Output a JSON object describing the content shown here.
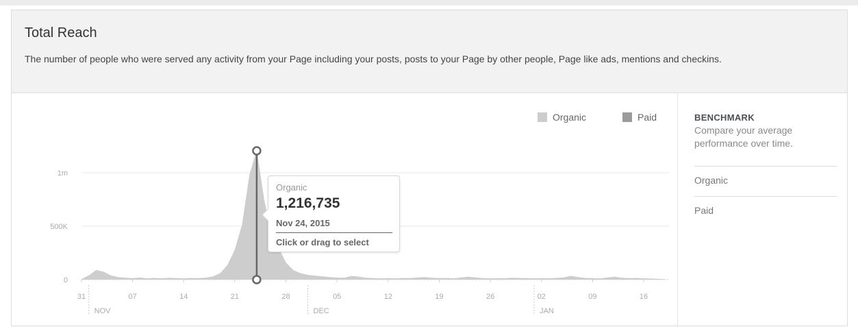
{
  "header": {
    "title": "Total Reach",
    "description": "The number of people who were served any activity from your Page including your posts, posts to your Page by other people, Page like ads, mentions and checkins."
  },
  "legend": [
    {
      "label": "Organic",
      "color": "#cdcdcd"
    },
    {
      "label": "Paid",
      "color": "#9b9b9b"
    }
  ],
  "benchmark": {
    "title": "BENCHMARK",
    "description": "Compare your average performance over time.",
    "items": [
      "Organic",
      "Paid"
    ]
  },
  "tooltip": {
    "series": "Organic",
    "value": "1,216,735",
    "date": "Nov 24, 2015",
    "hint": "Click or drag to select"
  },
  "chart_data": {
    "type": "area",
    "title": "Total Reach",
    "x_start": "2015-10-31",
    "x_end": "2016-01-19",
    "x_unit": "date",
    "ylim": [
      0,
      1300000
    ],
    "y_ticks": [
      {
        "value": 0,
        "label": "0"
      },
      {
        "value": 500000,
        "label": "500K"
      },
      {
        "value": 1000000,
        "label": "1m"
      }
    ],
    "x_ticks": [
      {
        "date": "2015-10-31",
        "label": "31"
      },
      {
        "date": "2015-11-07",
        "label": "07"
      },
      {
        "date": "2015-11-14",
        "label": "14"
      },
      {
        "date": "2015-11-21",
        "label": "21"
      },
      {
        "date": "2015-11-28",
        "label": "28"
      },
      {
        "date": "2015-12-05",
        "label": "05"
      },
      {
        "date": "2015-12-12",
        "label": "12"
      },
      {
        "date": "2015-12-19",
        "label": "19"
      },
      {
        "date": "2015-12-26",
        "label": "26"
      },
      {
        "date": "2016-01-02",
        "label": "02"
      },
      {
        "date": "2016-01-09",
        "label": "09"
      },
      {
        "date": "2016-01-16",
        "label": "16"
      }
    ],
    "month_labels": [
      {
        "date": "2015-11-01",
        "label": "NOV"
      },
      {
        "date": "2015-12-01",
        "label": "DEC"
      },
      {
        "date": "2016-01-01",
        "label": "JAN"
      }
    ],
    "series": [
      {
        "name": "Organic",
        "color": "#cdcdcd",
        "points": [
          [
            "2015-10-31",
            5000
          ],
          [
            "2015-11-01",
            40000
          ],
          [
            "2015-11-02",
            90000
          ],
          [
            "2015-11-03",
            75000
          ],
          [
            "2015-11-04",
            40000
          ],
          [
            "2015-11-05",
            25000
          ],
          [
            "2015-11-06",
            18000
          ],
          [
            "2015-11-07",
            15000
          ],
          [
            "2015-11-08",
            20000
          ],
          [
            "2015-11-09",
            12000
          ],
          [
            "2015-11-10",
            16000
          ],
          [
            "2015-11-11",
            13000
          ],
          [
            "2015-11-12",
            18000
          ],
          [
            "2015-11-13",
            14000
          ],
          [
            "2015-11-14",
            12000
          ],
          [
            "2015-11-15",
            16000
          ],
          [
            "2015-11-16",
            14000
          ],
          [
            "2015-11-17",
            18000
          ],
          [
            "2015-11-18",
            30000
          ],
          [
            "2015-11-19",
            60000
          ],
          [
            "2015-11-20",
            140000
          ],
          [
            "2015-11-21",
            280000
          ],
          [
            "2015-11-22",
            520000
          ],
          [
            "2015-11-23",
            980000
          ],
          [
            "2015-11-24",
            1216735
          ],
          [
            "2015-11-25",
            760000
          ],
          [
            "2015-11-26",
            420000
          ],
          [
            "2015-11-27",
            300000
          ],
          [
            "2015-11-28",
            160000
          ],
          [
            "2015-11-29",
            90000
          ],
          [
            "2015-11-30",
            60000
          ],
          [
            "2015-12-01",
            45000
          ],
          [
            "2015-12-02",
            38000
          ],
          [
            "2015-12-03",
            30000
          ],
          [
            "2015-12-04",
            24000
          ],
          [
            "2015-12-05",
            20000
          ],
          [
            "2015-12-06",
            18000
          ],
          [
            "2015-12-07",
            35000
          ],
          [
            "2015-12-08",
            28000
          ],
          [
            "2015-12-09",
            18000
          ],
          [
            "2015-12-10",
            14000
          ],
          [
            "2015-12-11",
            12000
          ],
          [
            "2015-12-12",
            15000
          ],
          [
            "2015-12-13",
            11000
          ],
          [
            "2015-12-14",
            16000
          ],
          [
            "2015-12-15",
            14000
          ],
          [
            "2015-12-16",
            20000
          ],
          [
            "2015-12-17",
            25000
          ],
          [
            "2015-12-18",
            18000
          ],
          [
            "2015-12-19",
            14000
          ],
          [
            "2015-12-20",
            16000
          ],
          [
            "2015-12-21",
            13000
          ],
          [
            "2015-12-22",
            20000
          ],
          [
            "2015-12-23",
            28000
          ],
          [
            "2015-12-24",
            20000
          ],
          [
            "2015-12-25",
            15000
          ],
          [
            "2015-12-26",
            12000
          ],
          [
            "2015-12-27",
            15000
          ],
          [
            "2015-12-28",
            13000
          ],
          [
            "2015-12-29",
            18000
          ],
          [
            "2015-12-30",
            16000
          ],
          [
            "2015-12-31",
            14000
          ],
          [
            "2016-01-01",
            12000
          ],
          [
            "2016-01-02",
            14000
          ],
          [
            "2016-01-03",
            13000
          ],
          [
            "2016-01-04",
            16000
          ],
          [
            "2016-01-05",
            20000
          ],
          [
            "2016-01-06",
            35000
          ],
          [
            "2016-01-07",
            25000
          ],
          [
            "2016-01-08",
            16000
          ],
          [
            "2016-01-09",
            14000
          ],
          [
            "2016-01-10",
            12000
          ],
          [
            "2016-01-11",
            20000
          ],
          [
            "2016-01-12",
            28000
          ],
          [
            "2016-01-13",
            18000
          ],
          [
            "2016-01-14",
            14000
          ],
          [
            "2016-01-15",
            16000
          ],
          [
            "2016-01-16",
            12000
          ],
          [
            "2016-01-17",
            10000
          ],
          [
            "2016-01-18",
            8000
          ],
          [
            "2016-01-19",
            4000
          ]
        ]
      },
      {
        "name": "Paid",
        "color": "#9b9b9b",
        "points": []
      }
    ],
    "highlight": {
      "date": "2015-11-24",
      "value": 1216735
    }
  }
}
